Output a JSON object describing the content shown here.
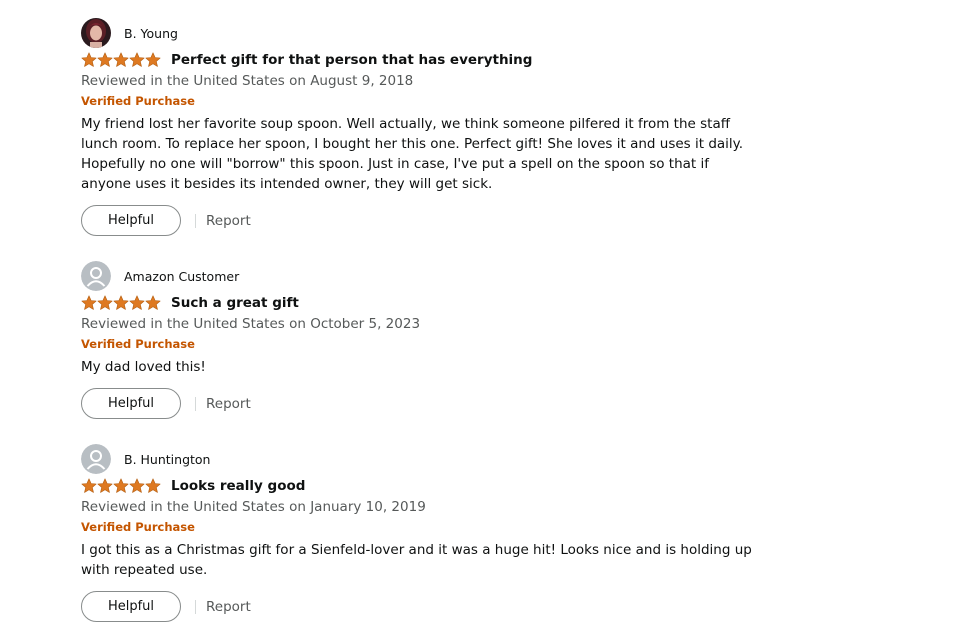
{
  "colors": {
    "star": "#de7921",
    "verified": "#c45500",
    "meta_text": "#565959",
    "body_text": "#0f1111"
  },
  "reviews": [
    {
      "profile_name": "B. Young",
      "avatar_type": "photo",
      "rating": 5,
      "title": "Perfect gift for that person that has everything",
      "date": "Reviewed in the United States on August 9, 2018",
      "verified": "Verified Purchase",
      "body": "My friend lost her favorite soup spoon. Well actually, we think someone pilfered it from the staff lunch room. To replace her spoon, I bought her this one. Perfect gift! She loves it and uses it daily. Hopefully no one will \"borrow\" this spoon. Just in case, I've put a spell on the spoon so that if anyone uses it besides its intended owner, they will get sick.",
      "helpful_label": "Helpful",
      "report_label": "Report"
    },
    {
      "profile_name": "Amazon Customer",
      "avatar_type": "default",
      "rating": 5,
      "title": "Such a great gift",
      "date": "Reviewed in the United States on October 5, 2023",
      "verified": "Verified Purchase",
      "body": "My dad loved this!",
      "helpful_label": "Helpful",
      "report_label": "Report"
    },
    {
      "profile_name": "B. Huntington",
      "avatar_type": "default",
      "rating": 5,
      "title": "Looks really good",
      "date": "Reviewed in the United States on January 10, 2019",
      "verified": "Verified Purchase",
      "body": "I got this as a Christmas gift for a Sienfeld-lover and it was a huge hit! Looks nice and is holding up with repeated use.",
      "helpful_label": "Helpful",
      "report_label": "Report"
    }
  ]
}
